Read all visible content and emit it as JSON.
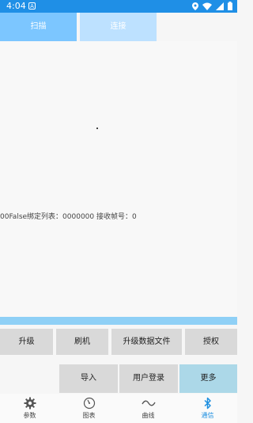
{
  "status_bar": {
    "time": "4:04",
    "badge": "A"
  },
  "tabs": [
    {
      "label": "扫描"
    },
    {
      "label": "连接"
    }
  ],
  "main": {
    "status_text": "00False绑定列表：0000000   接收帧号：0"
  },
  "buttons_row1": [
    {
      "label": "升级"
    },
    {
      "label": "刷机"
    },
    {
      "label": "升级数据文件"
    },
    {
      "label": "授权"
    }
  ],
  "buttons_row2": [
    {
      "label": "导入"
    },
    {
      "label": "用户登录"
    },
    {
      "label": "更多"
    }
  ],
  "bottom_nav": [
    {
      "label": "参数",
      "icon": "gear-icon"
    },
    {
      "label": "图表",
      "icon": "gauge-icon"
    },
    {
      "label": "曲线",
      "icon": "wave-icon"
    },
    {
      "label": "通信",
      "icon": "bluetooth-icon"
    }
  ],
  "colors": {
    "status_bar": "#1f8fe6",
    "tab_active": "#7cc6ff",
    "tab_inactive": "#bde1ff",
    "accent_bar": "#8fd0f6",
    "more_button": "#acd8e8",
    "nav_active": "#1d8fe0"
  }
}
